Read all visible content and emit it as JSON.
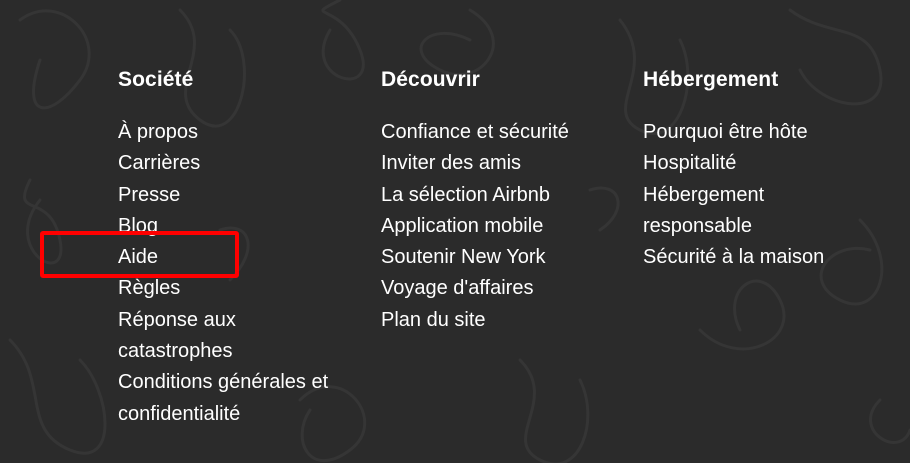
{
  "footer": {
    "columns": [
      {
        "heading": "Société",
        "links": [
          "À propos",
          "Carrières",
          "Presse",
          "Blog",
          "Aide",
          "Règles",
          "Réponse aux catastrophes",
          "Conditions générales et confidentialité"
        ]
      },
      {
        "heading": "Découvrir",
        "links": [
          "Confiance et sécurité",
          "Inviter des amis",
          "La sélection Airbnb",
          "Application mobile",
          "Soutenir New York",
          "Voyage d'affaires",
          "Plan du site"
        ]
      },
      {
        "heading": "Hébergement",
        "links": [
          "Pourquoi être hôte",
          "Hospitalité",
          "Hébergement responsable",
          "Sécurité à la maison"
        ]
      }
    ]
  },
  "colors": {
    "background": "#2b2b2b",
    "text": "#ffffff",
    "highlight": "#ff0000"
  }
}
